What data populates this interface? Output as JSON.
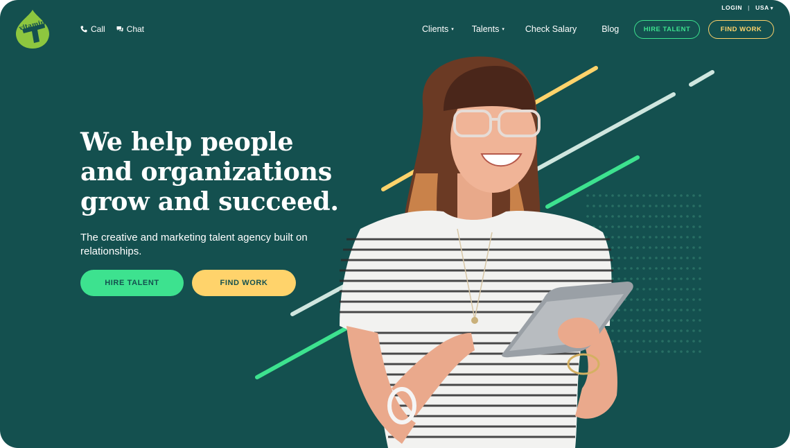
{
  "topbar": {
    "login": "LOGIN",
    "separator": "|",
    "region": "USA"
  },
  "logo": {
    "alt_text": "vitamin T"
  },
  "contact": {
    "call": "Call",
    "chat": "Chat"
  },
  "nav": {
    "items": [
      {
        "label": "Clients",
        "has_dropdown": true
      },
      {
        "label": "Talents",
        "has_dropdown": true
      },
      {
        "label": "Check Salary",
        "has_dropdown": false
      },
      {
        "label": "Blog",
        "has_dropdown": false
      }
    ],
    "hire_button": "HIRE TALENT",
    "find_button": "FIND WORK"
  },
  "hero": {
    "title_lines": [
      "We help people",
      "and organizations",
      "grow and succeed."
    ],
    "subtitle": "The creative and marketing talent agency built on relationships.",
    "hire_button": "HIRE TALENT",
    "find_button": "FIND WORK"
  },
  "colors": {
    "background": "#14504f",
    "green_accent": "#3de28f",
    "yellow_accent": "#ffd36b",
    "logo_green": "#8dc63f"
  },
  "icons": {
    "call": "phone-icon",
    "chat": "chat-bubble-icon",
    "dropdown": "caret-down-icon"
  }
}
